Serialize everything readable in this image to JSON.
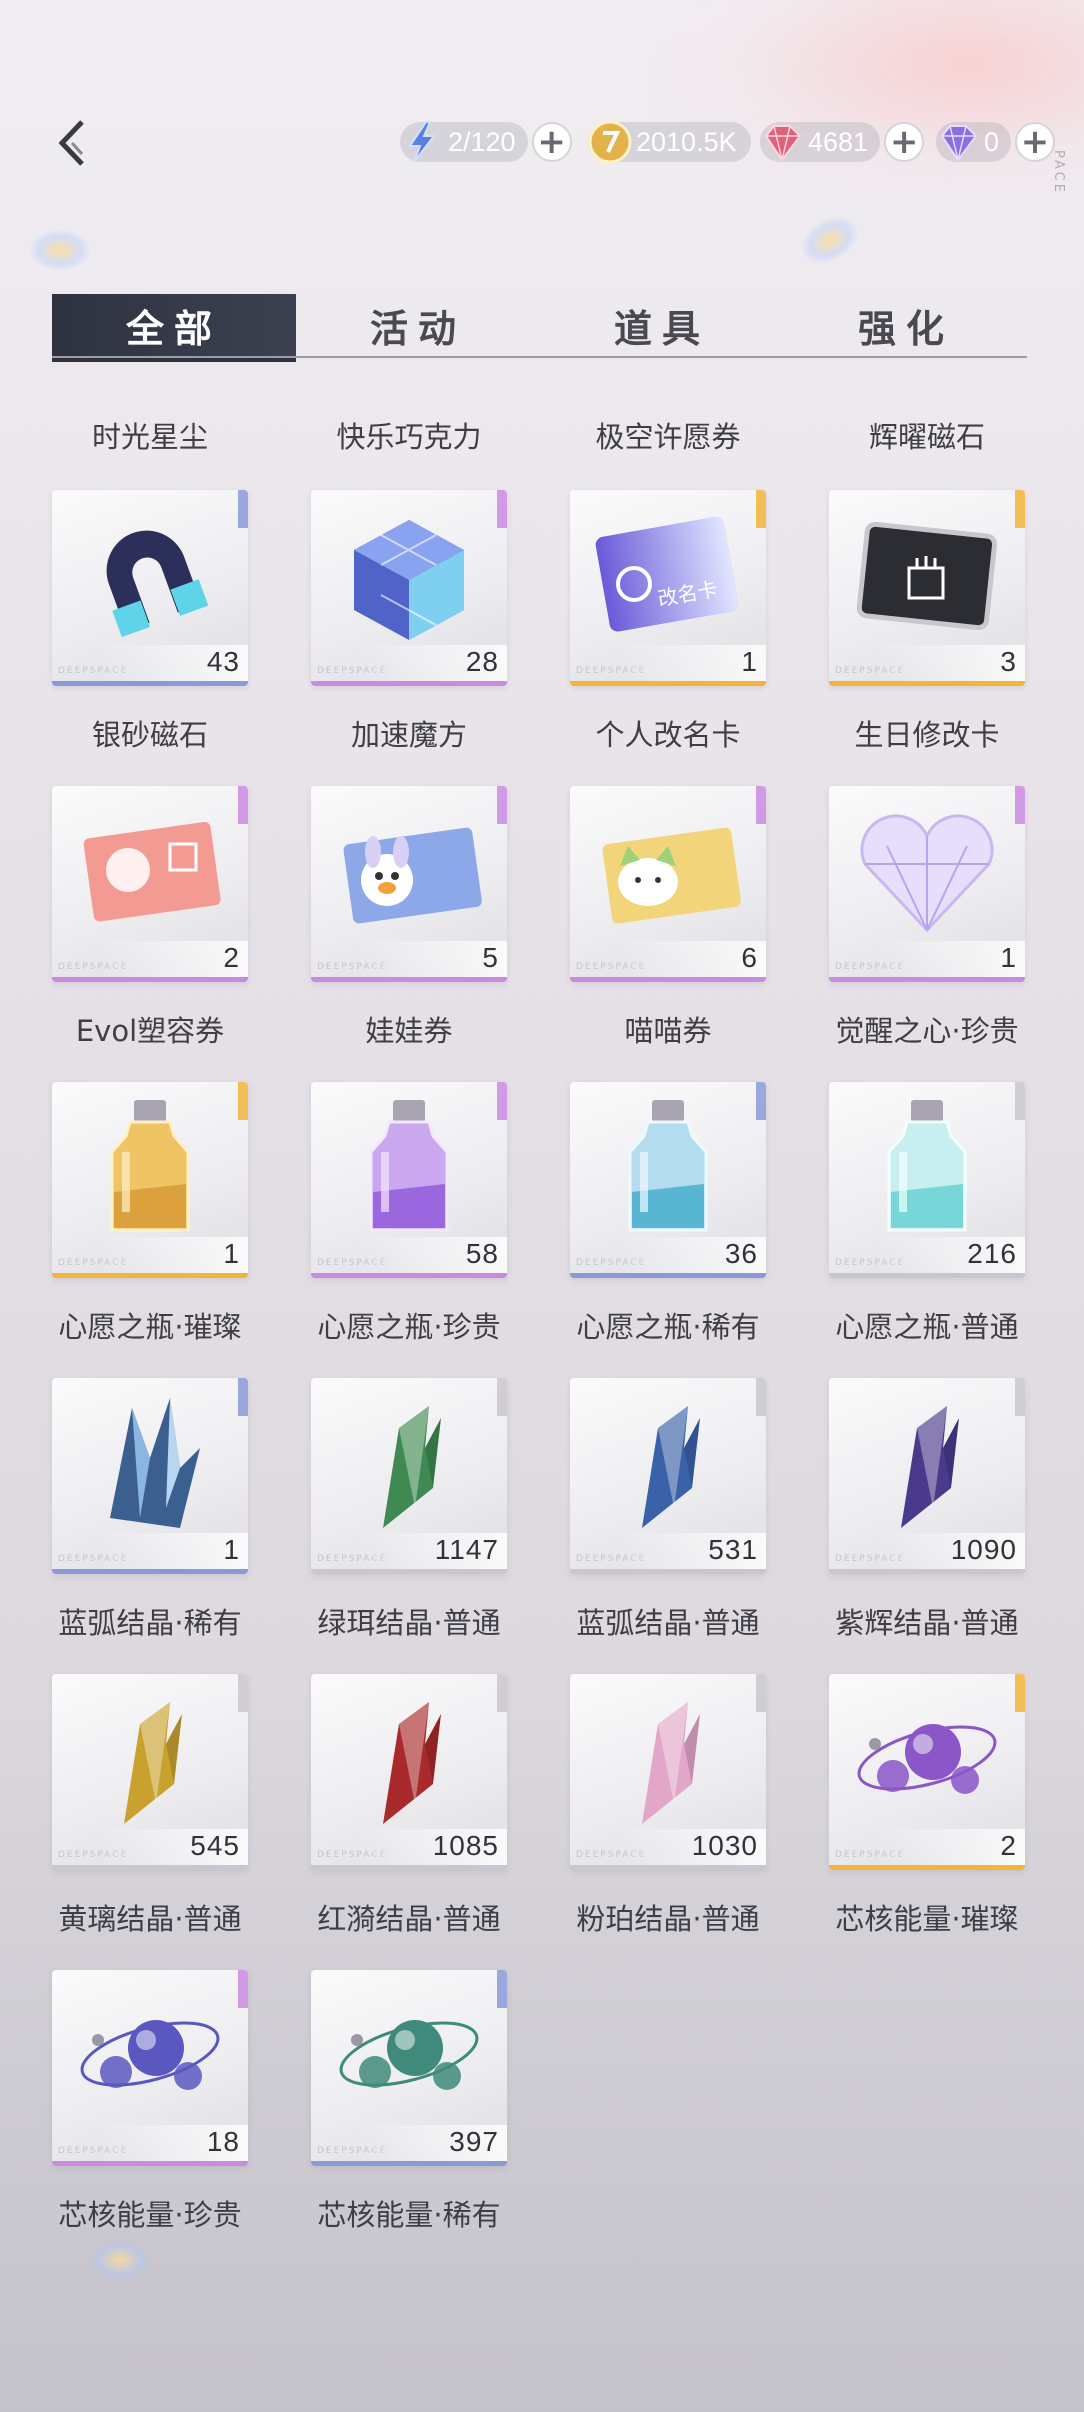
{
  "header": {
    "vertical_text": "PACE",
    "currencies": [
      {
        "icon": "lightning-stamina-icon",
        "value": "2/120",
        "has_plus": true
      },
      {
        "icon": "gold-coin-icon",
        "value": "2010.5K",
        "has_plus": false
      },
      {
        "icon": "red-diamond-icon",
        "value": "4681",
        "has_plus": true
      },
      {
        "icon": "purple-diamond-icon",
        "value": "0",
        "has_plus": true
      }
    ]
  },
  "tabs": [
    {
      "label": "全部",
      "active": true
    },
    {
      "label": "活动",
      "active": false
    },
    {
      "label": "道具",
      "active": false
    },
    {
      "label": "强化",
      "active": false
    }
  ],
  "top_labels": [
    "时光星尘",
    "快乐巧克力",
    "极空许愿券",
    "辉曜磁石"
  ],
  "items": [
    {
      "name": "银砂磁石",
      "qty": "43",
      "rarity": "blue",
      "art": "magnet"
    },
    {
      "name": "加速魔方",
      "qty": "28",
      "rarity": "purple",
      "art": "cube"
    },
    {
      "name": "个人改名卡",
      "qty": "1",
      "rarity": "gold",
      "art": "rename-card",
      "card_text": "改名卡"
    },
    {
      "name": "生日修改卡",
      "qty": "3",
      "rarity": "gold",
      "art": "birthday-card"
    },
    {
      "name": "Evol塑容券",
      "qty": "2",
      "rarity": "purple",
      "art": "pink-ticket"
    },
    {
      "name": "娃娃券",
      "qty": "5",
      "rarity": "purple",
      "art": "doll-ticket"
    },
    {
      "name": "喵喵券",
      "qty": "6",
      "rarity": "purple",
      "art": "cat-ticket"
    },
    {
      "name": "觉醒之心·珍贵",
      "qty": "1",
      "rarity": "purple",
      "art": "heart-gem"
    },
    {
      "name": "心愿之瓶·璀璨",
      "qty": "1",
      "rarity": "gold",
      "art": "bottle-gold"
    },
    {
      "name": "心愿之瓶·珍贵",
      "qty": "58",
      "rarity": "purple",
      "art": "bottle-purple"
    },
    {
      "name": "心愿之瓶·稀有",
      "qty": "36",
      "rarity": "blue",
      "art": "bottle-blue"
    },
    {
      "name": "心愿之瓶·普通",
      "qty": "216",
      "rarity": "gray",
      "art": "bottle-teal"
    },
    {
      "name": "蓝弧结晶·稀有",
      "qty": "1",
      "rarity": "blue",
      "art": "crystal-cluster"
    },
    {
      "name": "绿珥结晶·普通",
      "qty": "1147",
      "rarity": "gray",
      "art": "crystal",
      "color": "#3f8a52"
    },
    {
      "name": "蓝弧结晶·普通",
      "qty": "531",
      "rarity": "gray",
      "art": "crystal",
      "color": "#3a62a8"
    },
    {
      "name": "紫辉结晶·普通",
      "qty": "1090",
      "rarity": "gray",
      "art": "crystal",
      "color": "#4b3a8c"
    },
    {
      "name": "黄璃结晶·普通",
      "qty": "545",
      "rarity": "gray",
      "art": "crystal",
      "color": "#c9a12e"
    },
    {
      "name": "红漪结晶·普通",
      "qty": "1085",
      "rarity": "gray",
      "art": "crystal",
      "color": "#a82a2a"
    },
    {
      "name": "粉珀结晶·普通",
      "qty": "1030",
      "rarity": "gray",
      "art": "crystal",
      "color": "#e2a6c8"
    },
    {
      "name": "芯核能量·璀璨",
      "qty": "2",
      "rarity": "gold",
      "art": "orbs",
      "color": "#8a56c8"
    },
    {
      "name": "芯核能量·珍贵",
      "qty": "18",
      "rarity": "purple",
      "art": "orbs",
      "color": "#5a58c0"
    },
    {
      "name": "芯核能量·稀有",
      "qty": "397",
      "rarity": "blue",
      "art": "orbs",
      "color": "#3f8a7a"
    }
  ],
  "card_watermark": "DEEPSPACE",
  "rarity_colors": {
    "gold": "#f2b43a",
    "purple": "#c98be0",
    "blue": "#8a9ad8",
    "gray": "#c9c6cd"
  }
}
